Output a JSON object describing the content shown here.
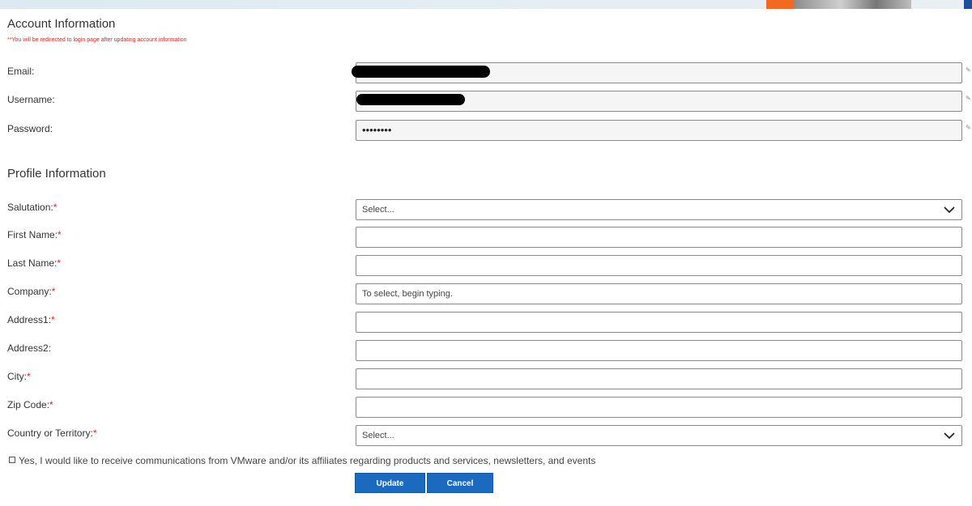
{
  "account": {
    "heading": "Account Information",
    "note": "**You will be redirected to login page after updating account information",
    "email_label": "Email:",
    "username_label": "Username:",
    "password_label": "Password:",
    "password_value": "••••••••"
  },
  "profile": {
    "heading": "Profile Information",
    "required_mark": "*",
    "salutation_label": "Salutation:",
    "salutation_value": "Select...",
    "first_name_label": "First Name:",
    "last_name_label": "Last Name:",
    "company_label": "Company:",
    "company_placeholder": "To select, begin typing.",
    "address1_label": "Address1:",
    "address2_label": "Address2:",
    "city_label": "City:",
    "zip_label": "Zip Code:",
    "country_label": "Country or Territory:",
    "country_value": "Select...",
    "communications_text": "Yes, I would like to receive communications from VMware and/or its affiliates regarding products and services, newsletters, and events"
  },
  "buttons": {
    "update": "Update",
    "cancel": "Cancel"
  },
  "colors": {
    "required": "#e2231a",
    "button_blue": "#1b6ac0"
  },
  "icons": [
    "pencil-icon",
    "chevron-down-icon",
    "checkbox"
  ]
}
